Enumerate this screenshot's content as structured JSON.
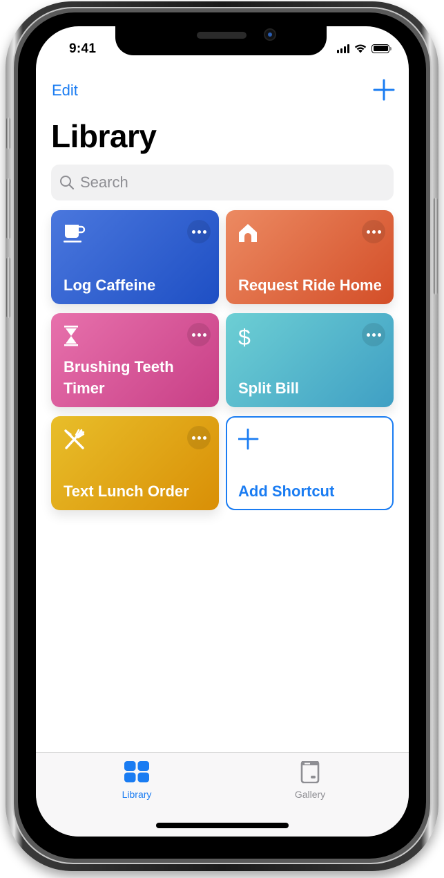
{
  "status_bar": {
    "time": "9:41",
    "icons": [
      "cellular-signal-icon",
      "wifi-icon",
      "battery-icon"
    ],
    "battery_level": 1.0
  },
  "nav": {
    "edit_label": "Edit",
    "add_icon": "plus-icon"
  },
  "page": {
    "title": "Library"
  },
  "search": {
    "placeholder": "Search",
    "value": "",
    "icon": "magnifying-glass-icon"
  },
  "colors": {
    "accent": "#1a7cf2",
    "tab_inactive": "#8e8e93"
  },
  "shortcuts": [
    {
      "title": "Log Caffeine",
      "icon": "coffee-cup-icon",
      "gradient": [
        "#4a77dd",
        "#1e4fc4"
      ]
    },
    {
      "title": "Request Ride Home",
      "icon": "house-icon",
      "gradient": [
        "#ec8a62",
        "#d34e28"
      ]
    },
    {
      "title": "Brushing Teeth Timer",
      "icon": "hourglass-icon",
      "gradient": [
        "#e771ac",
        "#c83f86"
      ]
    },
    {
      "title": "Split Bill",
      "icon": "dollar-sign-icon",
      "gradient": [
        "#6dcfd4",
        "#3f9fc4"
      ]
    },
    {
      "title": "Text Lunch Order",
      "icon": "fork-knife-icon",
      "gradient": [
        "#e8be2a",
        "#d98f06"
      ]
    }
  ],
  "add_shortcut": {
    "title": "Add Shortcut",
    "icon": "plus-icon"
  },
  "tabbar": {
    "tabs": [
      {
        "label": "Library",
        "icon": "grid-icon",
        "selected": true
      },
      {
        "label": "Gallery",
        "icon": "gallery-icon",
        "selected": false
      }
    ]
  }
}
